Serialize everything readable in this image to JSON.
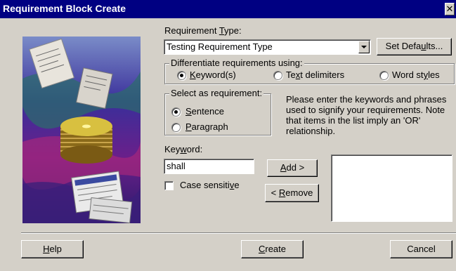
{
  "window": {
    "title": "Requirement Block Create",
    "close_glyph": "✕"
  },
  "requirement_type": {
    "label_pre": "Requirement ",
    "label_accel": "T",
    "label_post": "ype:",
    "value": "Testing Requirement Type"
  },
  "set_defaults_button": {
    "pre": "Set Defa",
    "accel": "u",
    "post": "lts..."
  },
  "differentiate_group": {
    "label": "Differentiate requirements using:",
    "options": [
      {
        "pre": "",
        "accel": "K",
        "post": "eyword(s)",
        "checked": true
      },
      {
        "pre": "Te",
        "accel": "x",
        "post": "t delimiters",
        "checked": false
      },
      {
        "pre": "Word st",
        "accel": "y",
        "post": "les",
        "checked": false
      }
    ]
  },
  "select_group": {
    "label": "Select as requirement:",
    "options": [
      {
        "pre": "",
        "accel": "S",
        "post": "entence",
        "checked": true
      },
      {
        "pre": "",
        "accel": "P",
        "post": "aragraph",
        "checked": false
      }
    ]
  },
  "help_text": [
    "Please enter the keywords and phrases",
    "used to signify your requirements. Note",
    "that items in the list imply an 'OR'",
    "relationship."
  ],
  "keyword": {
    "label_pre": "Key",
    "label_accel": "w",
    "label_post": "ord:",
    "value": "shall"
  },
  "case_sensitive": {
    "pre": "Case sensiti",
    "accel": "v",
    "post": "e",
    "checked": false
  },
  "add_button": {
    "pre": "",
    "accel": "A",
    "post": "dd >"
  },
  "remove_button": {
    "pre": "< ",
    "accel": "R",
    "post": "emove"
  },
  "keyword_list": [],
  "footer": {
    "help": {
      "pre": "",
      "accel": "H",
      "post": "elp"
    },
    "create": {
      "pre": "",
      "accel": "C",
      "post": "reate"
    },
    "cancel": "Cancel"
  }
}
